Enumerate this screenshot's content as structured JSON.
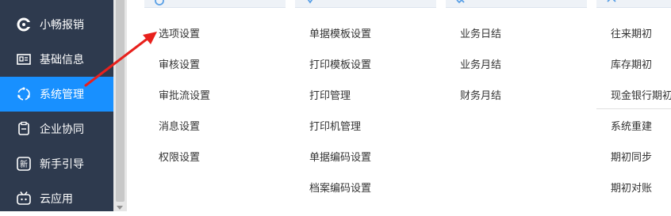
{
  "sidebar": {
    "items": [
      {
        "label": "小畅报销",
        "icon": "brand-logo-icon"
      },
      {
        "label": "基础信息",
        "icon": "id-card-icon"
      },
      {
        "label": "系统管理",
        "icon": "circle-dots-icon",
        "active": true
      },
      {
        "label": "企业协同",
        "icon": "collaboration-icon"
      },
      {
        "label": "新手引导",
        "icon": "new-badge-icon"
      },
      {
        "label": "云应用",
        "icon": "tv-icon"
      }
    ]
  },
  "columns": [
    {
      "links": [
        "选项设置",
        "审核设置",
        "审批流设置",
        "消息设置",
        "权限设置"
      ]
    },
    {
      "links": [
        "单据模板设置",
        "打印模板设置",
        "打印管理",
        "打印机管理",
        "单据编码设置",
        "档案编码设置"
      ]
    },
    {
      "links": [
        "业务日结",
        "业务月结",
        "财务月结"
      ]
    },
    {
      "links": [
        "往来期初",
        "库存期初",
        "现金银行期初",
        "系统重建",
        "期初同步",
        "期初对账"
      ]
    }
  ],
  "colors": {
    "sidebar_bg": "#2e3a4e",
    "active_bg": "#1890ff",
    "annotation_arrow": "#e8201c"
  }
}
